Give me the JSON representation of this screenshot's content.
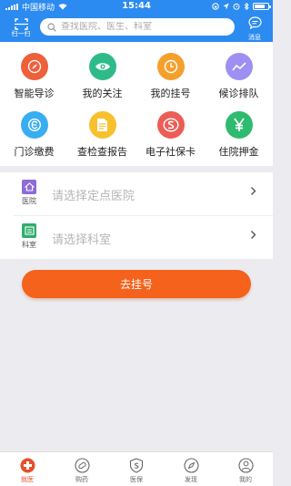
{
  "status_bar": {
    "carrier": "中国移动",
    "time": "15:44"
  },
  "header": {
    "scan_label": "扫一扫",
    "search_placeholder": "查找医院、医生、科室",
    "message_label": "消息",
    "color": "#2b8bf0"
  },
  "grid": {
    "items": [
      {
        "label": "智能导诊",
        "icon": "compass-icon",
        "color": "#ee5f3c"
      },
      {
        "label": "我的关注",
        "icon": "eye-icon",
        "color": "#2fbb89"
      },
      {
        "label": "我的挂号",
        "icon": "clock-icon",
        "color": "#f5a02c"
      },
      {
        "label": "候诊排队",
        "icon": "chart-line-icon",
        "color": "#9e8ff2"
      },
      {
        "label": "门诊缴费",
        "icon": "payment-icon",
        "color": "#38aef1"
      },
      {
        "label": "查检查报告",
        "icon": "report-icon",
        "color": "#f7c02d"
      },
      {
        "label": "电子社保卡",
        "icon": "social-security-icon",
        "color": "#ec5d56"
      },
      {
        "label": "住院押金",
        "icon": "yuan-icon",
        "color": "#2fbb6f"
      }
    ]
  },
  "selectors": {
    "hospital": {
      "badge": "医院",
      "placeholder": "请选择定点医院",
      "color": "#8e6bd8"
    },
    "department": {
      "badge": "科室",
      "placeholder": "请选择科室",
      "color": "#2fae6b"
    }
  },
  "actions": {
    "register_label": "去挂号",
    "register_color": "#f4621c"
  },
  "tabbar": {
    "tabs": [
      {
        "label": "就医",
        "active": true
      },
      {
        "label": "购药",
        "active": false
      },
      {
        "label": "医保",
        "active": false
      },
      {
        "label": "发现",
        "active": false
      },
      {
        "label": "我的",
        "active": false
      }
    ],
    "active_color": "#e5512a"
  }
}
